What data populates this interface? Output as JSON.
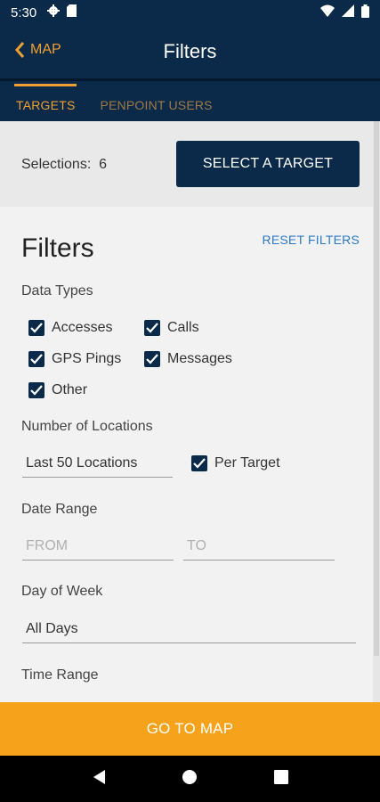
{
  "status_bar": {
    "time": "5:30"
  },
  "app_bar": {
    "back_label": "MAP",
    "title": "Filters"
  },
  "tabs": [
    {
      "label": "TARGETS",
      "active": true
    },
    {
      "label": "PENPOINT USERS",
      "active": false
    }
  ],
  "selection": {
    "label": "Selections:",
    "count": "6",
    "button_label": "SELECT A TARGET"
  },
  "filters": {
    "heading": "Filters",
    "reset_label": "RESET FILTERS",
    "data_types": {
      "label": "Data Types",
      "options": [
        {
          "label": "Accesses",
          "checked": true
        },
        {
          "label": "Calls",
          "checked": true
        },
        {
          "label": "GPS Pings",
          "checked": true
        },
        {
          "label": "Messages",
          "checked": true
        },
        {
          "label": "Other",
          "checked": true
        }
      ]
    },
    "locations": {
      "label": "Number of Locations",
      "value": "Last 50 Locations",
      "per_target_label": "Per Target",
      "per_target_checked": true
    },
    "date_range": {
      "label": "Date Range",
      "from_placeholder": "FROM",
      "to_placeholder": "TO"
    },
    "day_of_week": {
      "label": "Day of Week",
      "value": "All Days"
    },
    "time_range": {
      "label": "Time Range"
    }
  },
  "footer": {
    "button_label": "GO TO MAP"
  },
  "colors": {
    "navy": "#0b2a4a",
    "accent": "#f0a030",
    "link": "#2b79c9",
    "cta": "#f7a21b"
  }
}
